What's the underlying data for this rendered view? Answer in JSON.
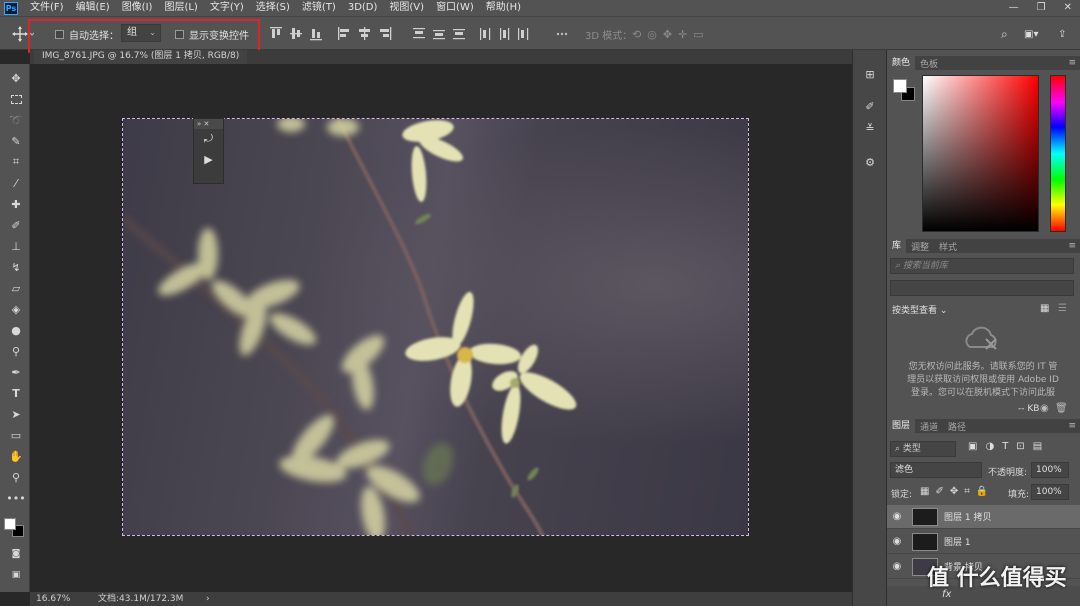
{
  "app": {
    "logo": "Ps"
  },
  "menu": [
    "文件(F)",
    "编辑(E)",
    "图像(I)",
    "图层(L)",
    "文字(Y)",
    "选择(S)",
    "滤镜(T)",
    "3D(D)",
    "视图(V)",
    "窗口(W)",
    "帮助(H)"
  ],
  "window_controls": {
    "minimize": "—",
    "restore": "❐",
    "close": "✕"
  },
  "options": {
    "auto_select_label": "自动选择：",
    "auto_select_value": "组",
    "show_transform_label": "显示变换控件",
    "mode_3d_label": "3D 模式："
  },
  "document": {
    "tab_title": "IMG_8761.JPG @ 16.7% (图层 1 拷贝, RGB/8)",
    "zoom": "16.67%",
    "doc_info": "文档:43.1M/172.3M"
  },
  "colors": {
    "accent": "#31a8ff",
    "highlight_box": "#e02424",
    "foreground": "#ffffff",
    "background": "#000000"
  },
  "panels": {
    "color_tabs": [
      "颜色",
      "色板"
    ],
    "library_tabs": [
      "库",
      "调整",
      "样式"
    ],
    "library_search_placeholder": "搜索当前库",
    "view_by_type": "按类型查看",
    "no_access_message": [
      "您无权访问此服务。请联系您的 IT 管",
      "理员以获取访问权限或使用 Adobe ID",
      "登录。您可以在脱机模式下访问此服"
    ],
    "kb_label": "-- KB",
    "layers_tabs": [
      "图层",
      "通道",
      "路径"
    ],
    "filter_kind": "类型",
    "blend_mode": "滤色",
    "opacity_label": "不透明度:",
    "opacity_value": "100%",
    "lock_label": "锁定:",
    "fill_label": "填充:",
    "fill_value": "100%",
    "layers": [
      {
        "name": "图层 1 拷贝",
        "selected": true
      },
      {
        "name": "图层 1",
        "selected": false
      },
      {
        "name": "背景 拷贝",
        "selected": false
      }
    ],
    "fx_label": "fx"
  },
  "watermark": "值 什么值得买"
}
